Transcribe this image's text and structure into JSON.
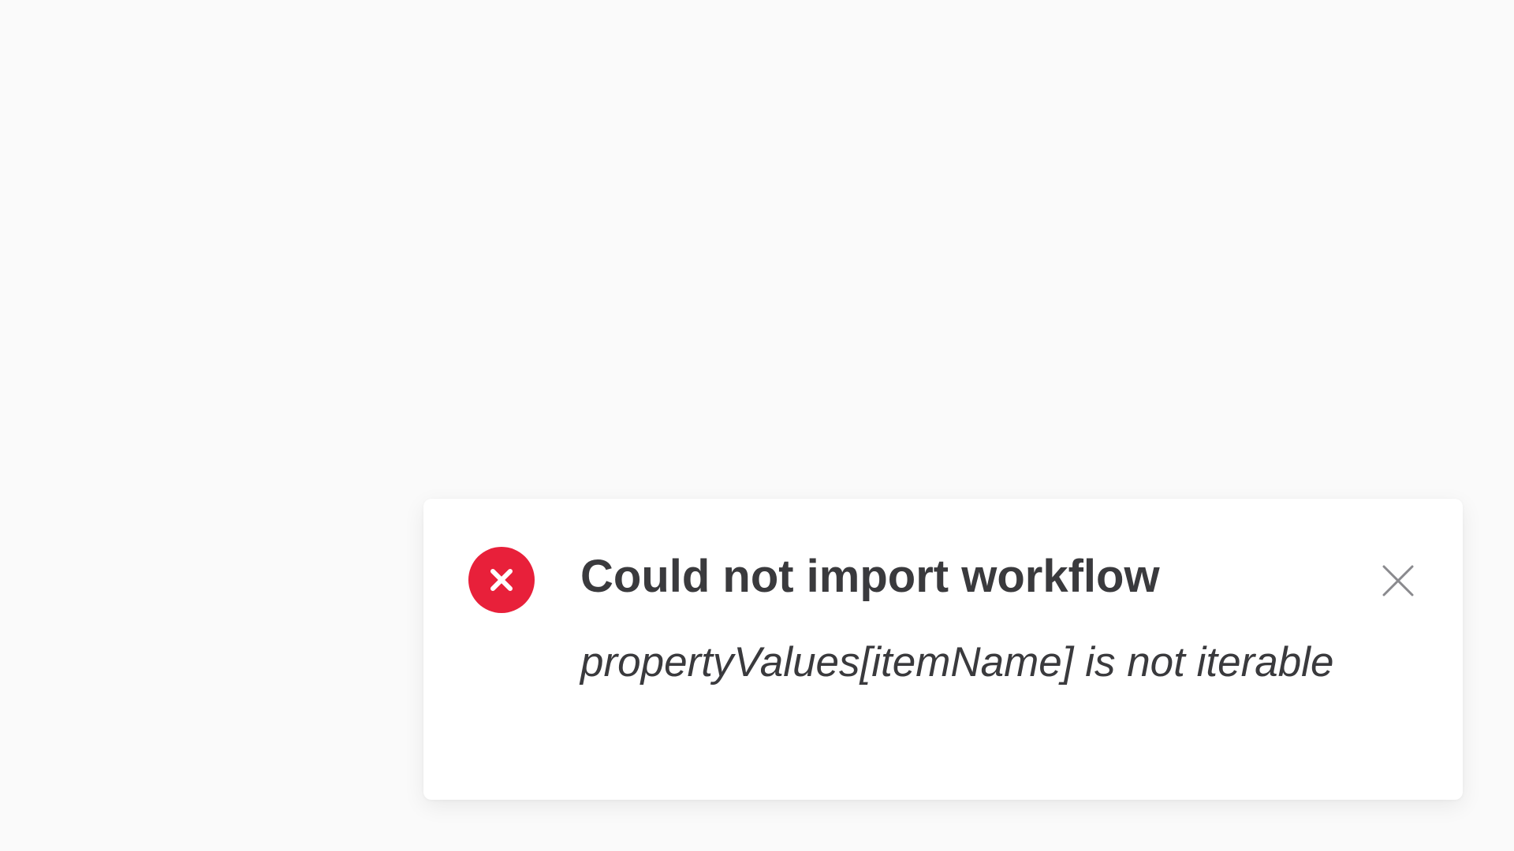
{
  "notification": {
    "type": "error",
    "title": "Could not import workflow",
    "message": "propertyValues[itemName] is not iterable",
    "status_icon": "error-x-circle-icon",
    "close_icon": "close-icon"
  },
  "colors": {
    "page_background": "#fafafa",
    "card_background": "#ffffff",
    "error_red": "#e8203a",
    "text_dark": "#3a3a3d",
    "close_gray": "#8a8a8e"
  }
}
